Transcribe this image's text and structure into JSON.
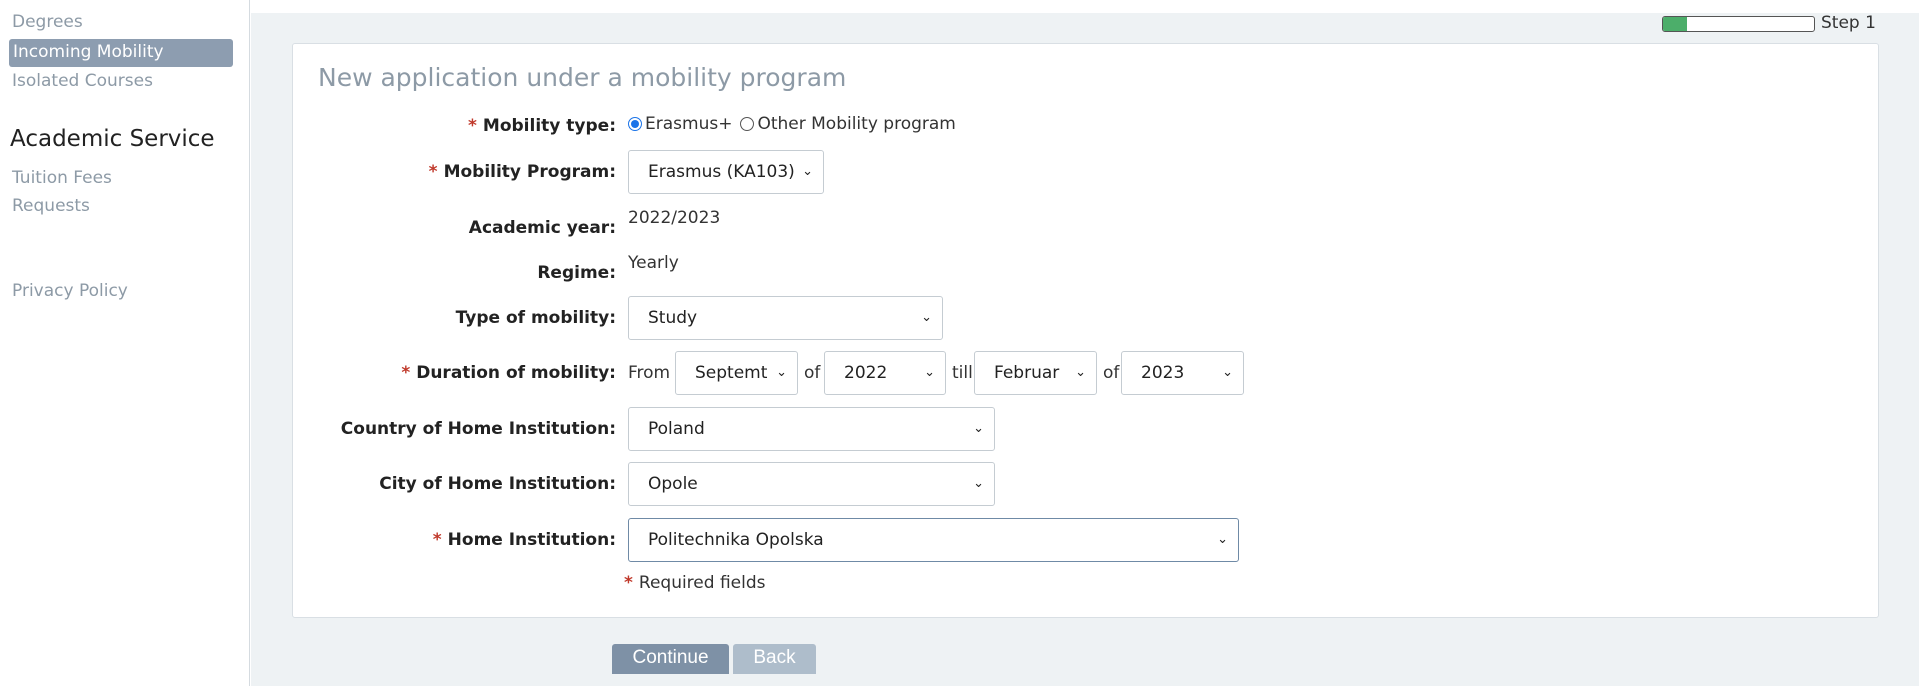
{
  "sidebar": {
    "links_top": [
      "Degrees",
      "Incoming Mobility",
      "Isolated Courses"
    ],
    "active_link": "Incoming Mobility",
    "section_heading": "Academic Service",
    "links_service": [
      "Tuition Fees",
      "Requests"
    ],
    "privacy_link": "Privacy Policy"
  },
  "progress": {
    "step_label": "Step 1",
    "fraction": 0.16,
    "fill_color": "#4cae6a"
  },
  "form": {
    "title": "New application under a mobility program",
    "required_marker": "*",
    "mobility_type": {
      "label": "Mobility type:",
      "options": [
        "Erasmus+",
        "Other Mobility program"
      ],
      "selected": "Erasmus+"
    },
    "mobility_program": {
      "label": "Mobility Program:",
      "value": "Erasmus (KA103)"
    },
    "academic_year": {
      "label": "Academic year:",
      "value": "2022/2023"
    },
    "regime": {
      "label": "Regime:",
      "value": "Yearly"
    },
    "type_of_mobility": {
      "label": "Type of mobility:",
      "value": "Study"
    },
    "duration": {
      "label": "Duration of mobility:",
      "from_text": "From",
      "of_text": "of",
      "till_text": "till",
      "from_month": "Septemt",
      "from_year": "2022",
      "till_month": "Februar",
      "till_year": "2023"
    },
    "country": {
      "label": "Country of Home Institution:",
      "value": "Poland"
    },
    "city": {
      "label": "City of Home Institution:",
      "value": "Opole"
    },
    "home_institution": {
      "label": "Home Institution:",
      "value": "Politechnika Opolska"
    },
    "required_note": "Required fields"
  },
  "buttons": {
    "continue": "Continue",
    "back": "Back"
  }
}
